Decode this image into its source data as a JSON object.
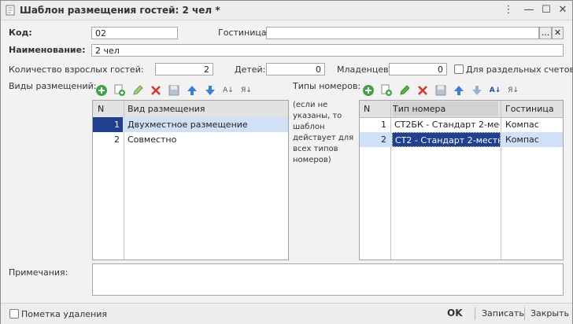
{
  "window": {
    "title": "Шаблон размещения гостей: 2 чел *"
  },
  "form": {
    "code_label": "Код:",
    "code_value": "02",
    "hotel_label": "Гостиница:",
    "hotel_value": "",
    "hotel_select": "...",
    "hotel_clear": "✕",
    "name_label": "Наименование:",
    "name_value": "2 чел",
    "adults_label": "Количество взрослых гостей:",
    "adults_value": "2",
    "children_label": "Детей:",
    "children_value": "0",
    "infants_label": "Младенцев:",
    "infants_value": "0",
    "separate_bills_label": "Для раздельных счетов",
    "placement_types_label": "Виды размещений:",
    "room_types_label": "Типы номеров:",
    "room_types_hint": [
      "(если не",
      "указаны, то",
      "шаблон",
      "действует для",
      "всех типов",
      "номеров)"
    ],
    "notes_label": "Примечания:",
    "delete_mark_label": "Пометка удаления"
  },
  "placements_table": {
    "columns": [
      "N",
      "Вид размещения"
    ],
    "rows": [
      {
        "n": "1",
        "name": "Двухместное размещение",
        "selected": true
      },
      {
        "n": "2",
        "name": "Совместно",
        "selected": false
      }
    ]
  },
  "rooms_table": {
    "columns": [
      "N",
      "Тип номера",
      "Гостиница"
    ],
    "rows": [
      {
        "n": "1",
        "type": "СТ2БК - Стандарт 2-мес...",
        "hotel": "Компас",
        "selected": false
      },
      {
        "n": "2",
        "type": "СТ2 - Стандарт 2-местн...",
        "hotel": "Компас",
        "selected": true
      }
    ]
  },
  "buttons": {
    "ok": "OK",
    "save": "Записать",
    "close": "Закрыть"
  },
  "colors": {
    "accent_selected": "#1f3f8f",
    "row_highlight": "#cfe0f7",
    "add_green": "#3ea34a",
    "delete_red": "#d8332b",
    "arrow_blue": "#3b7fd4"
  }
}
